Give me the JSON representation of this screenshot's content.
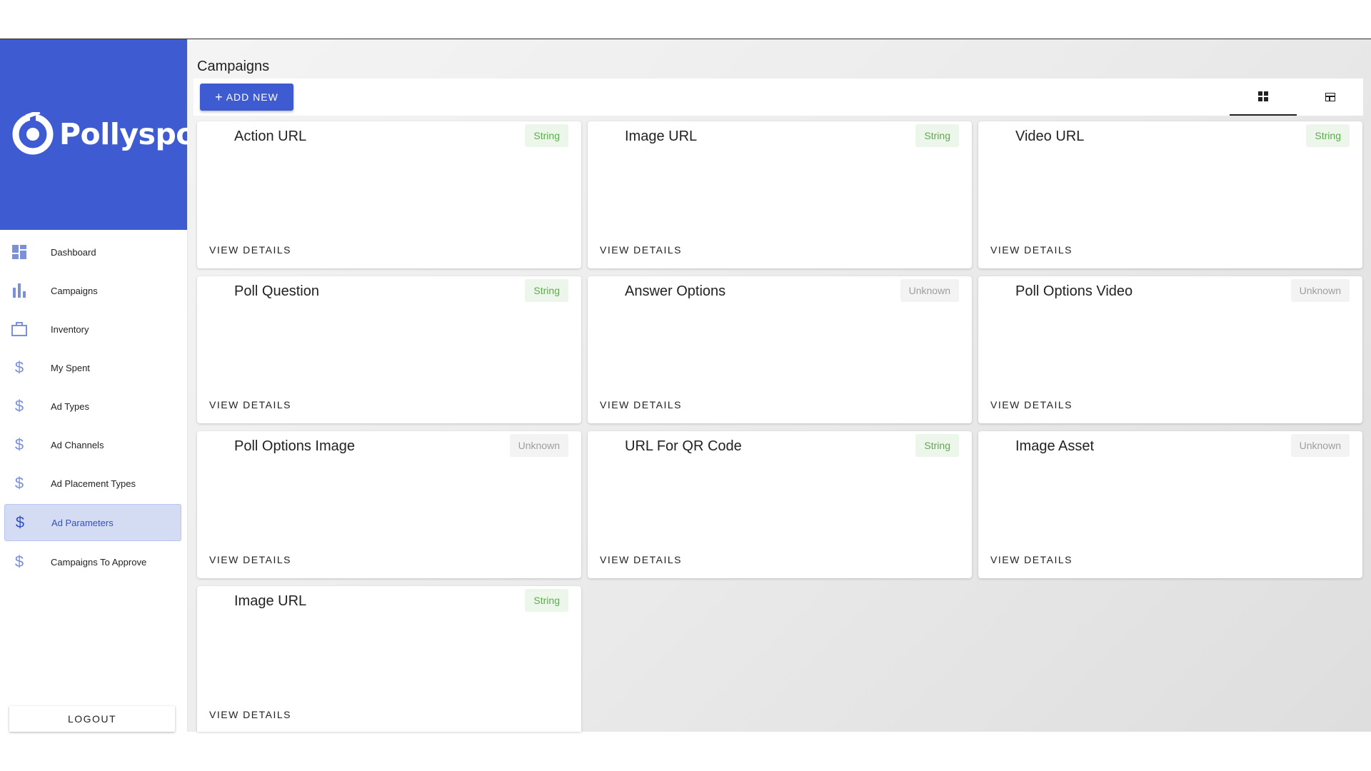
{
  "brand": {
    "name": "Pollyspot",
    "color": "#3f5bd1"
  },
  "sidebar": {
    "items": [
      {
        "label": "Dashboard",
        "icon": "dashboard-icon"
      },
      {
        "label": "Campaigns",
        "icon": "bar-chart-icon"
      },
      {
        "label": "Inventory",
        "icon": "briefcase-icon"
      },
      {
        "label": "My Spent",
        "icon": "dollar-icon"
      },
      {
        "label": "Ad Types",
        "icon": "dollar-icon"
      },
      {
        "label": "Ad Channels",
        "icon": "dollar-icon"
      },
      {
        "label": "Ad Placement Types",
        "icon": "dollar-icon"
      },
      {
        "label": "Ad Parameters",
        "icon": "dollar-icon",
        "active": true
      },
      {
        "label": "Campaigns To Approve",
        "icon": "dollar-icon"
      }
    ],
    "logout_label": "LOGOUT"
  },
  "main": {
    "title": "Campaigns",
    "add_button_label": "ADD NEW",
    "view_modes": [
      "grid",
      "table"
    ],
    "active_view": "grid",
    "cards": [
      {
        "title": "Action URL",
        "chip": "String"
      },
      {
        "title": "Image URL",
        "chip": "String"
      },
      {
        "title": "Video URL",
        "chip": "String"
      },
      {
        "title": "Poll Question",
        "chip": "String"
      },
      {
        "title": "Answer Options",
        "chip": "Unknown"
      },
      {
        "title": "Poll Options Video",
        "chip": "Unknown"
      },
      {
        "title": "Poll Options Image",
        "chip": "Unknown"
      },
      {
        "title": "URL For QR Code",
        "chip": "String"
      },
      {
        "title": "Image Asset",
        "chip": "Unknown"
      },
      {
        "title": "Image URL",
        "chip": "String"
      }
    ],
    "view_details_label": "VIEW DETAILS"
  }
}
